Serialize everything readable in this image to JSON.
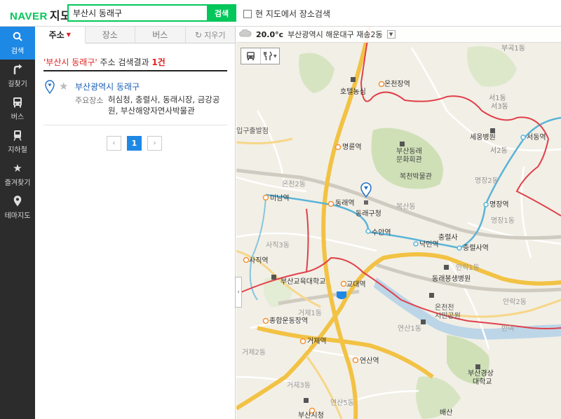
{
  "header": {
    "logo": "NAVER",
    "logo_sub": "지도",
    "search_value": "부산시 동래구",
    "search_button": "검색",
    "current_map_search_label": "현 지도에서 장소검색"
  },
  "leftnav": [
    {
      "label": "검색",
      "icon": "search-icon",
      "active": true
    },
    {
      "label": "길찾기",
      "icon": "turn-arrow-icon",
      "active": false
    },
    {
      "label": "버스",
      "icon": "bus-icon",
      "active": false
    },
    {
      "label": "지하철",
      "icon": "subway-icon",
      "active": false
    },
    {
      "label": "즐겨찾기",
      "icon": "star-icon",
      "active": false
    },
    {
      "label": "테마지도",
      "icon": "map-pin-icon",
      "active": false
    }
  ],
  "tabs": {
    "address": "주소",
    "place": "장소",
    "bus": "버스",
    "reset": "지우기"
  },
  "result": {
    "query": "'부산시 동래구'",
    "suffix": " 주소 검색결과 ",
    "count": "1건",
    "place_name": "부산광역시 동래구",
    "major_label": "주요장소",
    "major_places": "허심청, 충렬사, 동래시장, 금강공원, 부산해양자연사박물관"
  },
  "pager": {
    "prev": "‹",
    "current": "1",
    "next": "›"
  },
  "weather": {
    "temp": "20.0°c",
    "location": "부산광역시 해운대구 재송2동"
  },
  "map": {
    "labels": {
      "bugok1": "부곡1동",
      "oncheon_station": "온천장역",
      "hotel_nongsim": "호텔농심",
      "seo1": "서1동",
      "seo3": "서3동",
      "seoul_gate": "입구출발점",
      "myeongnyun_station": "명륜역",
      "museum_top": "부산동래",
      "museum_mid": "문화회관",
      "bokcheon": "복천박물관",
      "seoul_hospital": "세웅병원",
      "seodong_station": "서동역",
      "seo2": "서2동",
      "oncheon2": "온천2동",
      "myeongjang2": "명장2동",
      "minam_station": "미남역",
      "dongnae_station": "동래역",
      "office": "동래구청",
      "boksan": "복산동",
      "myeongjang_station": "명장역",
      "myeongjang1": "명장1동",
      "suan_station": "수안역",
      "chungnyeolsa": "충렬사",
      "nakmin_station": "낙민역",
      "chungnyeolsa_station": "충렬사역",
      "sajik3": "사직3동",
      "sajik_station": "사직역",
      "anrak1": "안락1동",
      "university": "부산교육대학교",
      "kyodae_station": "교대역",
      "bongseng": "동래봉생병원",
      "anrak2": "안락2동",
      "geoje1": "거제1동",
      "oncheoncheon": "온천천",
      "citizen_park": "시민공원",
      "sports_complex": "종합운동장역",
      "yeonsan1": "연산1동",
      "geoje2": "거제2동",
      "geoje_station": "거제역",
      "banyeo": "반여",
      "yeonsan_station": "연산역",
      "geoje3": "거제3동",
      "gyeongsang_top": "부산경상",
      "gyeongsang_mid": "대학교",
      "yeonsan5": "연산5동",
      "busan_city_hall": "부산시청",
      "bansan": "배산"
    }
  },
  "colors": {
    "naver_green": "#03c75a",
    "accent_blue": "#1e88e5",
    "highlight_red": "#e02020",
    "boundary_red": "#e0404a",
    "road_yellow": "#f2c244",
    "subway_line": "#5ab4d8"
  }
}
